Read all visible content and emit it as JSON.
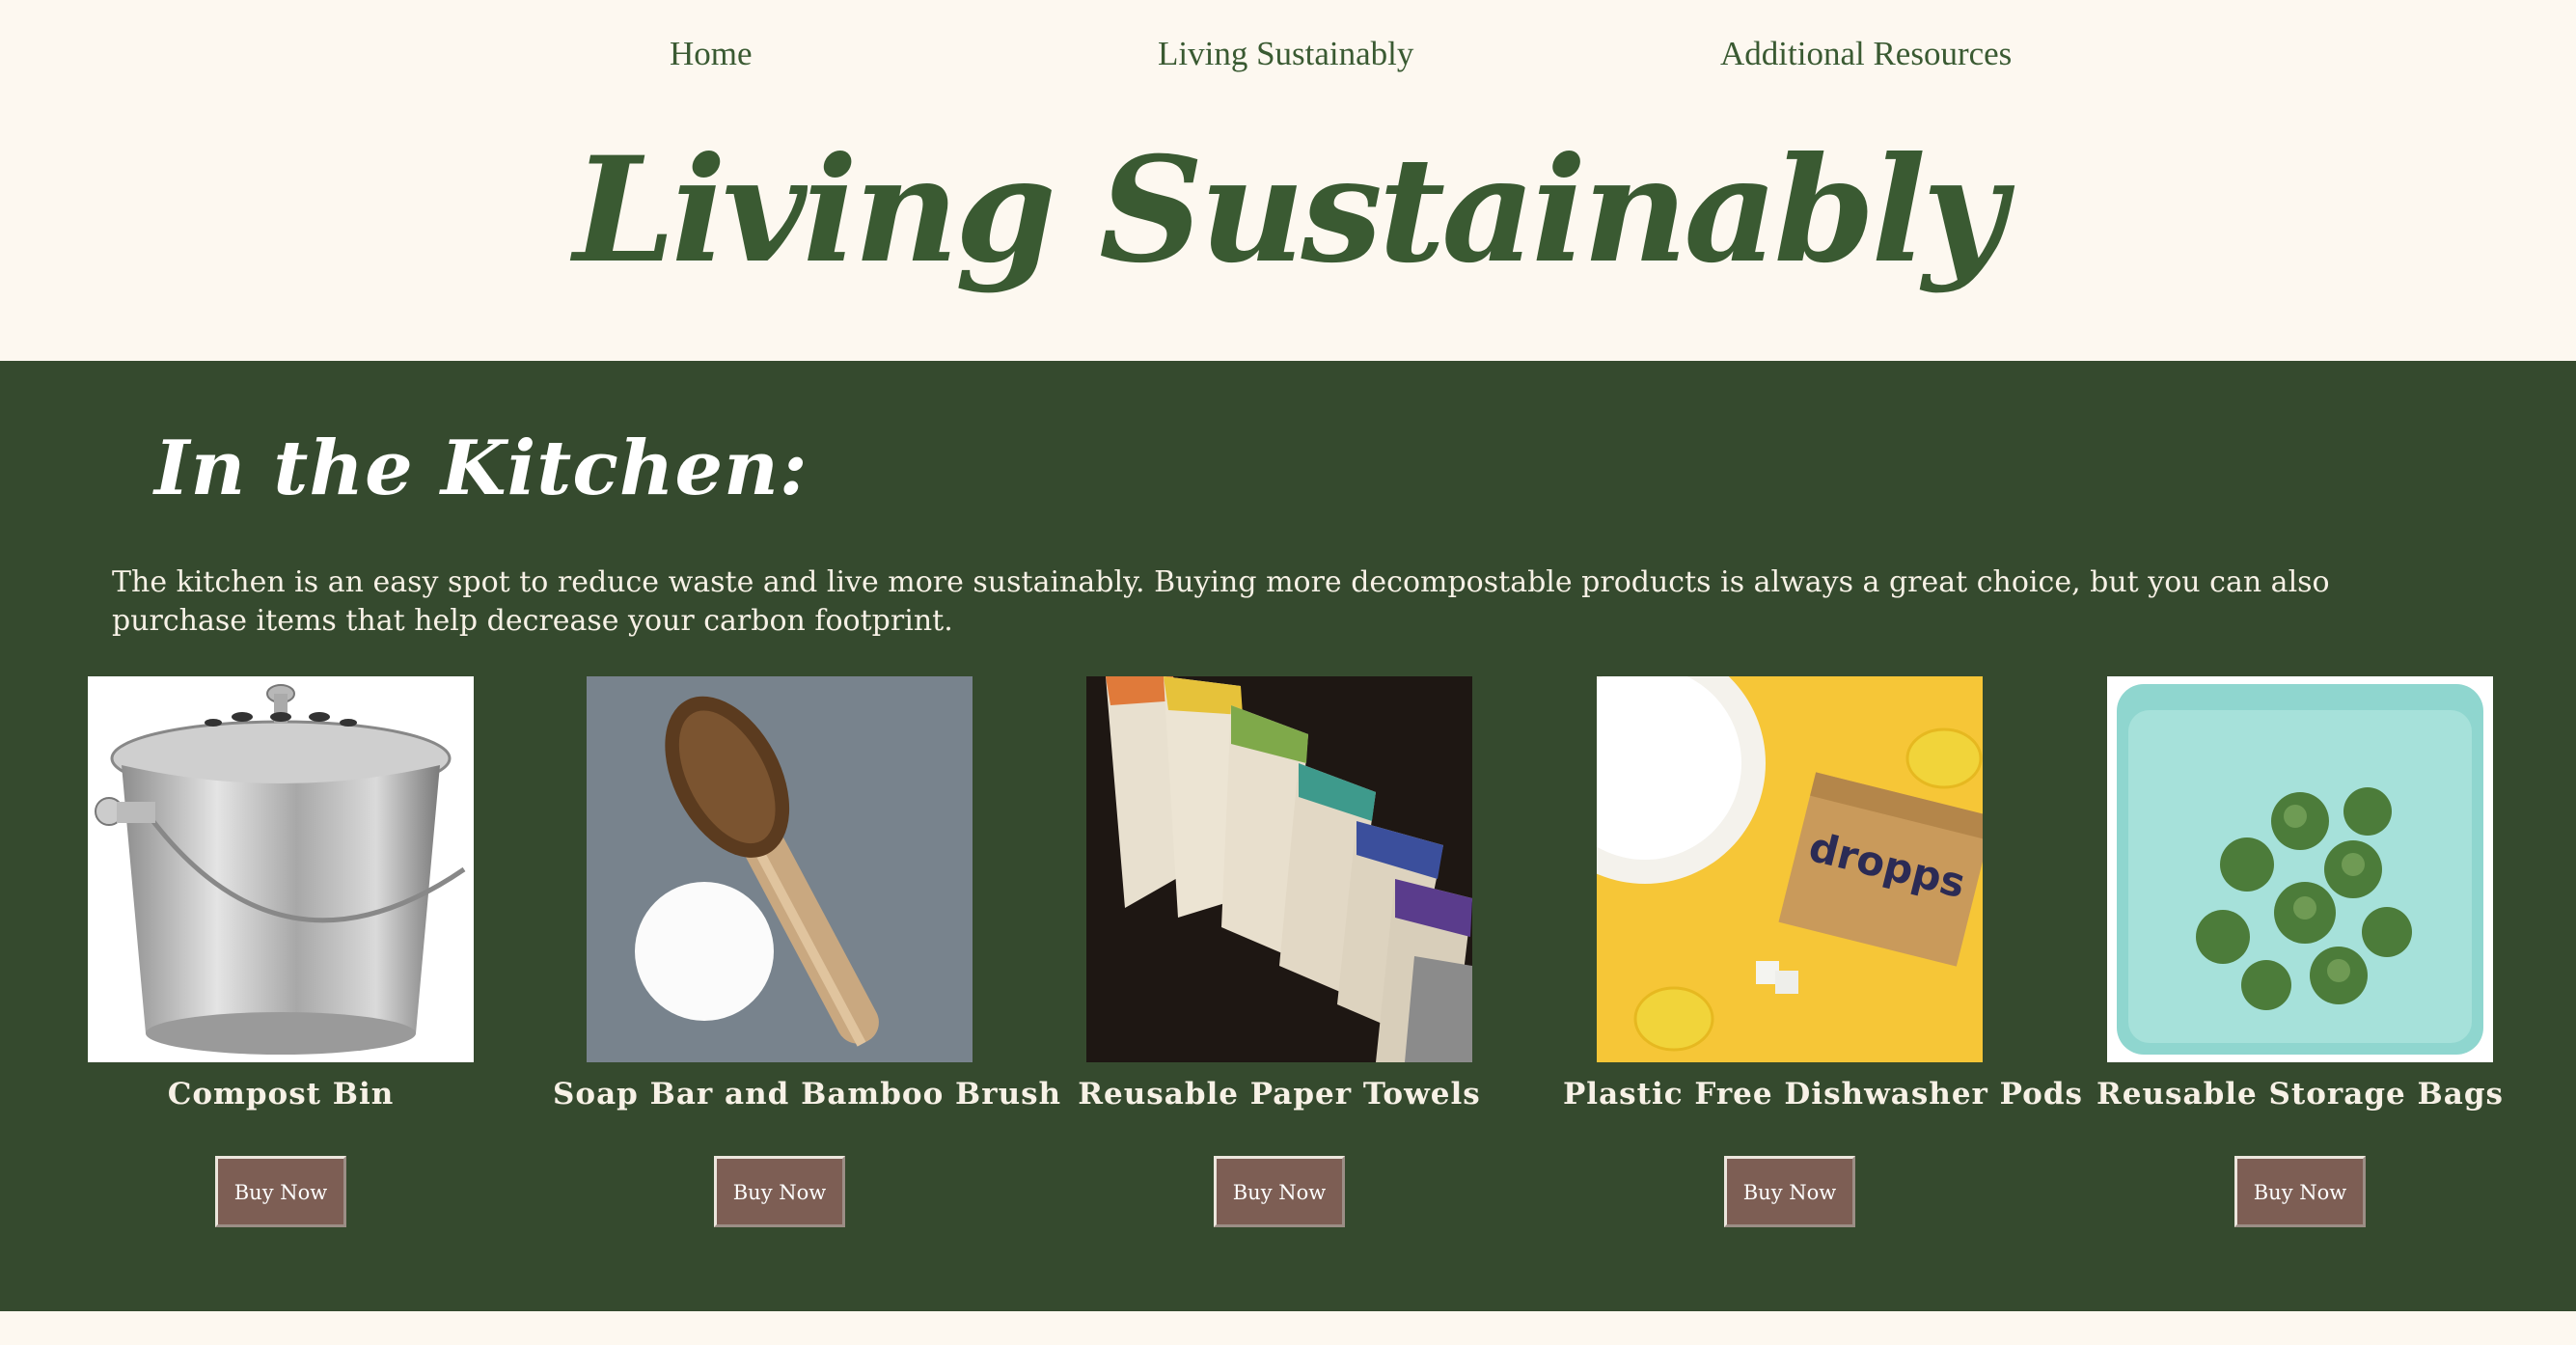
{
  "nav": {
    "items": [
      "Home",
      "Living Sustainably",
      "Additional Resources"
    ]
  },
  "hero": {
    "title": "Living Sustainably"
  },
  "kitchen": {
    "heading": "In the Kitchen:",
    "intro": "The kitchen is an easy spot to reduce waste and live more sustainably. Buying more decompostable products is always a great choice, but you can also purchase items that help decrease your carbon footprint.",
    "products": [
      {
        "name": "Compost Bin",
        "button": "Buy Now",
        "icon": "compost-bin-image"
      },
      {
        "name": "Soap Bar and Bamboo Brush",
        "button": "Buy Now",
        "icon": "soap-brush-image"
      },
      {
        "name": "Reusable Paper Towels",
        "button": "Buy Now",
        "icon": "paper-towels-image"
      },
      {
        "name": "Plastic Free Dishwasher Pods",
        "button": "Buy Now",
        "icon": "dishwasher-pods-image"
      },
      {
        "name": "Reusable Storage Bags",
        "button": "Buy Now",
        "icon": "storage-bag-image"
      }
    ],
    "pods_box_text": "dropps"
  },
  "colors": {
    "background": "#fdf8f0",
    "band": "#354a2e",
    "accent": "#3a5a32",
    "button": "#7d5e54"
  }
}
